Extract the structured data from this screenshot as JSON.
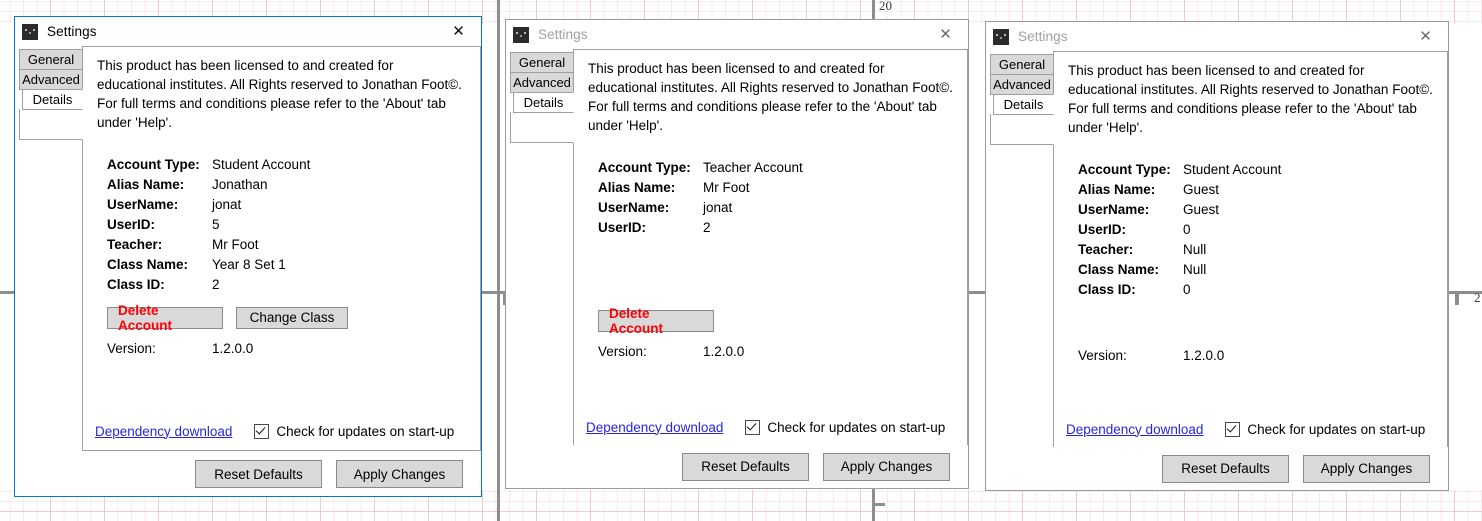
{
  "backdrop": {
    "ruler_label_top": "20",
    "ruler_label_right": "2"
  },
  "common": {
    "title": "Settings",
    "app_icon": "app-icon",
    "close_icon": "✕",
    "tabs": [
      "General",
      "Advanced",
      "Details"
    ],
    "selected_tab": "Details",
    "blurb": "This product has been licensed to and created for educational institutes. All Rights reserved to Jonathan Foot©. For full terms and conditions please refer to the 'About' tab under 'Help'.",
    "labels": {
      "account_type": "Account Type:",
      "alias_name": "Alias Name:",
      "username": "UserName:",
      "userid": "UserID:",
      "teacher": "Teacher:",
      "class_name": "Class Name:",
      "class_id": "Class ID:",
      "version": "Version:"
    },
    "buttons": {
      "delete_account": "Delete Account",
      "change_class": "Change Class",
      "reset_defaults": "Reset Defaults",
      "apply_changes": "Apply Changes"
    },
    "footer": {
      "dependency_link": "Dependency download",
      "check_updates_label": "Check for updates on start-up",
      "check_updates_checked": true
    },
    "colors": {
      "active_border": "#0078d7",
      "inactive_border": "#9b9b9b",
      "danger_text": "#fb0007",
      "link": "#2727d6",
      "button_face": "#d9d9d9"
    }
  },
  "windows": [
    {
      "state": "active",
      "title": "Settings",
      "fields": [
        {
          "key": "Account Type:",
          "value": "Student Account"
        },
        {
          "key": "Alias Name:",
          "value": "Jonathan"
        },
        {
          "key": "UserName:",
          "value": "jonat"
        },
        {
          "key": "UserID:",
          "value": "5"
        },
        {
          "key": "Teacher:",
          "value": "Mr Foot"
        },
        {
          "key": "Class Name:",
          "value": "Year 8 Set 1"
        },
        {
          "key": "Class ID:",
          "value": "2"
        }
      ],
      "has_delete_button": true,
      "has_change_class_button": true,
      "version_label": "Version:",
      "version_value": "1.2.0.0"
    },
    {
      "state": "inactive",
      "title": "Settings",
      "fields": [
        {
          "key": "Account Type:",
          "value": "Teacher Account"
        },
        {
          "key": "Alias Name:",
          "value": "Mr Foot"
        },
        {
          "key": "UserName:",
          "value": "jonat"
        },
        {
          "key": "UserID:",
          "value": "2"
        }
      ],
      "has_delete_button": true,
      "has_change_class_button": false,
      "version_label": "Version:",
      "version_value": "1.2.0.0"
    },
    {
      "state": "inactive",
      "title": "Settings",
      "fields": [
        {
          "key": "Account Type:",
          "value": "Student Account"
        },
        {
          "key": "Alias Name:",
          "value": "Guest"
        },
        {
          "key": "UserName:",
          "value": "Guest"
        },
        {
          "key": "UserID:",
          "value": "0"
        },
        {
          "key": "Teacher:",
          "value": "Null"
        },
        {
          "key": "Class Name:",
          "value": "Null"
        },
        {
          "key": "Class ID:",
          "value": "0"
        }
      ],
      "has_delete_button": false,
      "has_change_class_button": false,
      "version_label": "Version:",
      "version_value": "1.2.0.0"
    }
  ]
}
